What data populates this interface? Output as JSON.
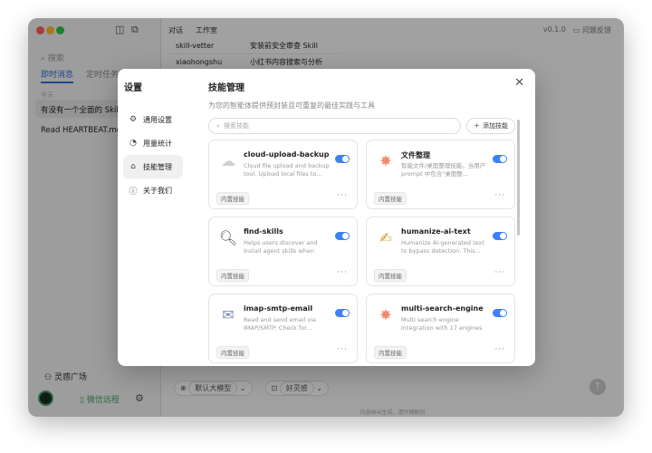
{
  "background": {
    "sidebar": {
      "search_placeholder": "搜索",
      "tabs": [
        "即时消息",
        "定时任务"
      ],
      "section_label": "今天",
      "items": [
        "有没有一个全面的 Skill 列",
        "Read HEARTBEAT.md if"
      ],
      "inspiration": "灵感广场",
      "wechat": "微信远程"
    },
    "main": {
      "tabs": [
        "对话",
        "工作室"
      ],
      "version": "v0.1.0",
      "feedback": "问题反馈",
      "table_rows": [
        {
          "name": "skill-vetter",
          "desc": "安装前安全审查 Skill"
        },
        {
          "name": "xiaohongshu",
          "desc": "小红书内容搜索与分析"
        }
      ],
      "model": "默认大模型",
      "agent": "好灵感",
      "footer": "内容由AI生成，请仔细甄别"
    }
  },
  "modal": {
    "title": "设置",
    "nav": [
      {
        "label": "通用设置",
        "icon": "gear-icon"
      },
      {
        "label": "用量统计",
        "icon": "chart-icon"
      },
      {
        "label": "技能管理",
        "icon": "skill-icon"
      },
      {
        "label": "关于我们",
        "icon": "info-icon"
      }
    ],
    "content_title": "技能管理",
    "description": "为您的智能体提供预封装且可重复的最佳实践与工具",
    "search_placeholder": "搜索技能",
    "add_label": "添加技能",
    "tag_label": "内置技能",
    "skills": [
      {
        "name": "cloud-upload-backup",
        "desc": "Cloud file upload and backup tool. Upload local files to...",
        "icon": "cloud-icon",
        "enabled": true
      },
      {
        "name": "文件整理",
        "desc": "智能文件/桌面整理技能。当用户 prompt 中包含\"桌面整...",
        "icon": "sparkle-icon",
        "enabled": true
      },
      {
        "name": "find-skills",
        "desc": "Helps users discover and install agent skills when they...",
        "icon": "magnifier-icon",
        "enabled": true
      },
      {
        "name": "humanize-ai-text",
        "desc": "Humanize AI-generated text to bypass detection. This...",
        "icon": "pen-icon",
        "enabled": true
      },
      {
        "name": "imap-smtp-email",
        "desc": "Read and send email via IMAP/SMTP. Check for...",
        "icon": "mail-icon",
        "enabled": true
      },
      {
        "name": "multi-search-engine",
        "desc": "Multi search engine integration with 17 engines (...",
        "icon": "sparkle-icon",
        "enabled": true
      }
    ]
  }
}
